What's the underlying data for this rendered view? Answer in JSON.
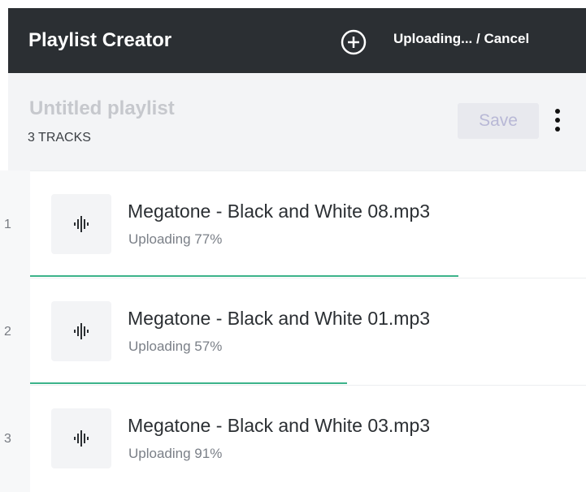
{
  "app": {
    "title": "Playlist Creator",
    "upload_status": "Uploading... / Cancel",
    "add_icon": "plus-circle-icon"
  },
  "playlist": {
    "name": "Untitled playlist",
    "track_count": "3 TRACKS",
    "save_label": "Save",
    "more_icon": "more-vertical-icon"
  },
  "tracks": [
    {
      "index": "1",
      "name": "Megatone - Black and White 08.mp3",
      "status": "Uploading 77%",
      "progress": 0.77,
      "icon": "audio-waveform-icon"
    },
    {
      "index": "2",
      "name": "Megatone - Black and White 01.mp3",
      "status": "Uploading 57%",
      "progress": 0.57,
      "icon": "audio-waveform-icon"
    },
    {
      "index": "3",
      "name": "Megatone - Black and White 03.mp3",
      "status": "Uploading 91%",
      "progress": 0.91,
      "icon": "audio-waveform-icon"
    }
  ],
  "colors": {
    "topbar": "#2b2f33",
    "accent_progress": "#3cb38a",
    "save_bg": "#e8e9ee",
    "save_text": "#b8b8d6"
  }
}
